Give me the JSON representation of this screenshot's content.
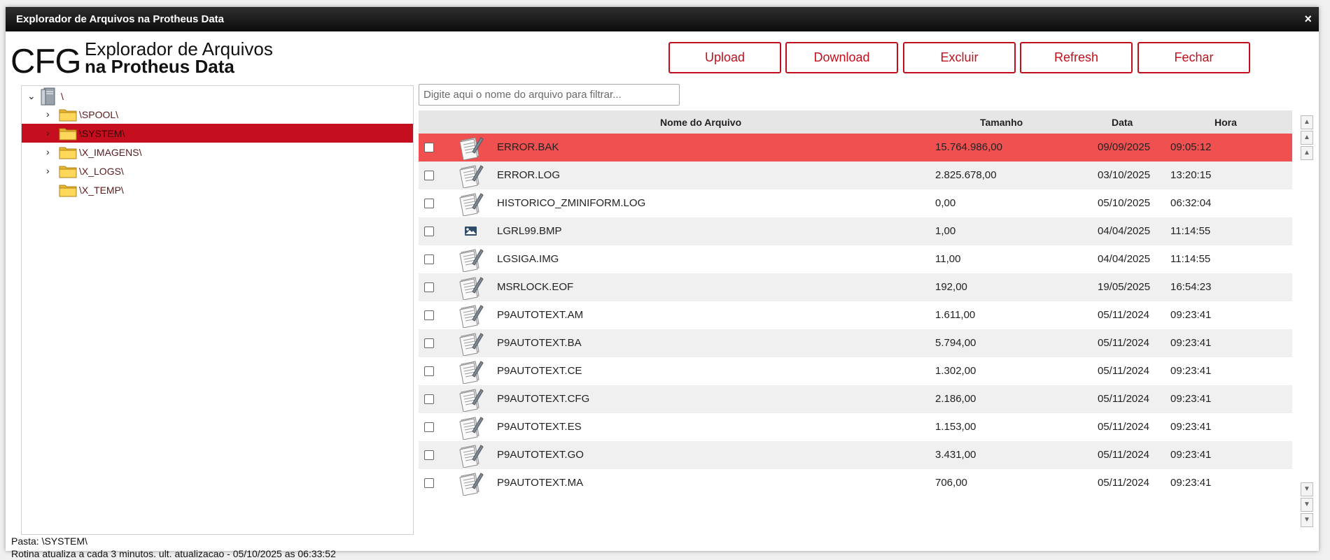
{
  "window": {
    "title": "Explorador de Arquivos na Protheus Data",
    "close": "×"
  },
  "logo": {
    "cfg": "CFG",
    "line1": "Explorador de Arquivos",
    "line2": "na Protheus Data"
  },
  "toolbar": {
    "upload": "Upload",
    "download": "Download",
    "excluir": "Excluir",
    "refresh": "Refresh",
    "fechar": "Fechar"
  },
  "tree": {
    "root": "\\",
    "items": [
      {
        "label": "\\SPOOL\\",
        "expandable": true,
        "selected": false
      },
      {
        "label": "\\SYSTEM\\",
        "expandable": true,
        "selected": true
      },
      {
        "label": "\\X_IMAGENS\\",
        "expandable": true,
        "selected": false
      },
      {
        "label": "\\X_LOGS\\",
        "expandable": true,
        "selected": false
      },
      {
        "label": "\\X_TEMP\\",
        "expandable": false,
        "selected": false
      }
    ]
  },
  "filter": {
    "placeholder": "Digite aqui o nome do arquivo para filtrar...",
    "value": ""
  },
  "grid": {
    "headers": {
      "name": "Nome do Arquivo",
      "size": "Tamanho",
      "date": "Data",
      "time": "Hora"
    },
    "rows": [
      {
        "icon": "document-icon",
        "name": "ERROR.BAK",
        "size": "15.764.986,00",
        "date": "09/09/2025",
        "time": "09:05:12",
        "selected": true
      },
      {
        "icon": "document-icon",
        "name": "ERROR.LOG",
        "size": "2.825.678,00",
        "date": "03/10/2025",
        "time": "13:20:15"
      },
      {
        "icon": "document-icon",
        "name": "HISTORICO_ZMINIFORM.LOG",
        "size": "0,00",
        "date": "05/10/2025",
        "time": "06:32:04"
      },
      {
        "icon": "image-icon",
        "name": "LGRL99.BMP",
        "size": "1,00",
        "date": "04/04/2025",
        "time": "11:14:55"
      },
      {
        "icon": "document-icon",
        "name": "LGSIGA.IMG",
        "size": "11,00",
        "date": "04/04/2025",
        "time": "11:14:55"
      },
      {
        "icon": "document-icon",
        "name": "MSRLOCK.EOF",
        "size": "192,00",
        "date": "19/05/2025",
        "time": "16:54:23"
      },
      {
        "icon": "document-icon",
        "name": "P9AUTOTEXT.AM",
        "size": "1.611,00",
        "date": "05/11/2024",
        "time": "09:23:41"
      },
      {
        "icon": "document-icon",
        "name": "P9AUTOTEXT.BA",
        "size": "5.794,00",
        "date": "05/11/2024",
        "time": "09:23:41"
      },
      {
        "icon": "document-icon",
        "name": "P9AUTOTEXT.CE",
        "size": "1.302,00",
        "date": "05/11/2024",
        "time": "09:23:41"
      },
      {
        "icon": "document-icon",
        "name": "P9AUTOTEXT.CFG",
        "size": "2.186,00",
        "date": "05/11/2024",
        "time": "09:23:41"
      },
      {
        "icon": "document-icon",
        "name": "P9AUTOTEXT.ES",
        "size": "1.153,00",
        "date": "05/11/2024",
        "time": "09:23:41"
      },
      {
        "icon": "document-icon",
        "name": "P9AUTOTEXT.GO",
        "size": "3.431,00",
        "date": "05/11/2024",
        "time": "09:23:41"
      },
      {
        "icon": "document-icon",
        "name": "P9AUTOTEXT.MA",
        "size": "706,00",
        "date": "05/11/2024",
        "time": "09:23:41"
      }
    ]
  },
  "status": {
    "folder": "Pasta: \\SYSTEM\\",
    "refresh": "Rotina atualiza a cada 3 minutos. ult. atualizacao - 05/10/2025 as 06:33:52"
  },
  "colors": {
    "accent": "#c0101c",
    "tree_selected": "#c50f1f",
    "row_selected": "#f05050"
  }
}
